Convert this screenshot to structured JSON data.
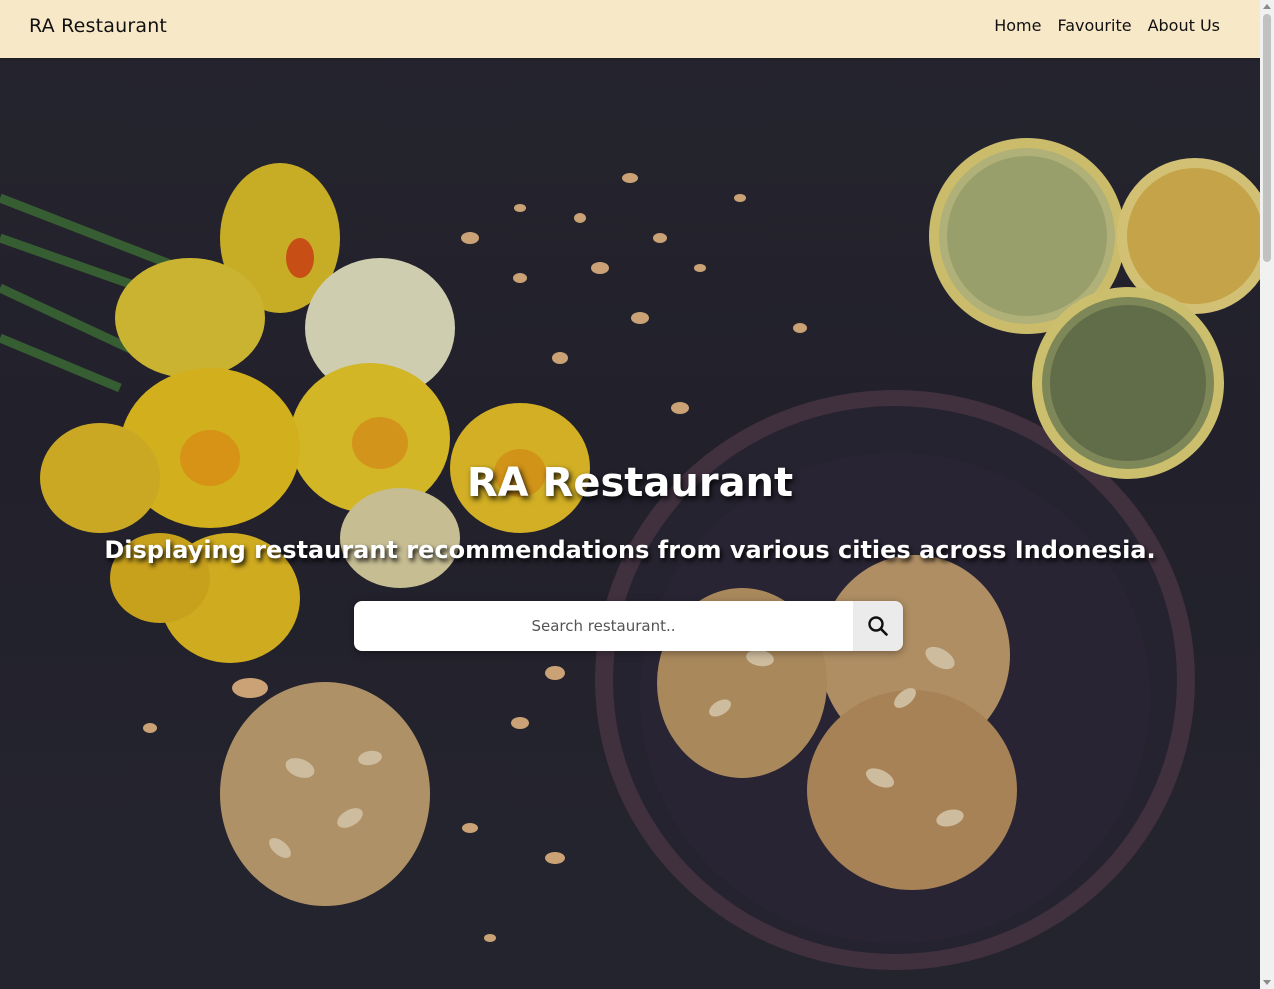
{
  "navbar": {
    "brand": "RA Restaurant",
    "links": [
      {
        "label": "Home"
      },
      {
        "label": "Favourite"
      },
      {
        "label": "About Us"
      }
    ],
    "background": "#f7e8c7"
  },
  "hero": {
    "title": "RA Restaurant",
    "subtitle": "Displaying restaurant recommendations from various cities across Indonesia.",
    "background_image": "food-photo: daffodil flowers, lemon slices, almond cookies in a dark bowl on a dark surface"
  },
  "search": {
    "placeholder": "Search restaurant..",
    "value": "",
    "button_icon": "search-icon"
  }
}
